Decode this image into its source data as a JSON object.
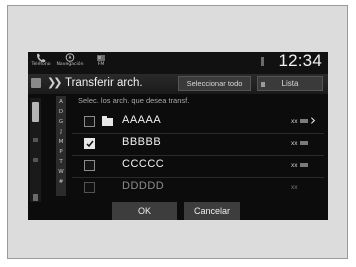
{
  "status_bar": {
    "items": [
      {
        "label": "Teléfono",
        "icon": "phone-icon"
      },
      {
        "label": "Navegación",
        "icon": "navigation-icon"
      },
      {
        "label": "FM",
        "icon": "radio-icon"
      }
    ],
    "time": "12:34"
  },
  "header": {
    "back_icon": "double-chevron-icon",
    "title": "Transferir arch.",
    "select_all_label": "Seleccionar todo",
    "list_label": "Lista"
  },
  "list": {
    "instruction": "Selec. los arch. que desea transf.",
    "alphabet_index": [
      "A",
      "D",
      "G",
      "J",
      "M",
      "P",
      "T",
      "W",
      "#"
    ],
    "rows": [
      {
        "name": "AAAAA",
        "checked": false,
        "folder": true,
        "meta": "xx"
      },
      {
        "name": "BBBBB",
        "checked": true,
        "folder": false,
        "meta": "xx"
      },
      {
        "name": "CCCCC",
        "checked": false,
        "folder": false,
        "meta": "xx"
      },
      {
        "name": "DDDDD",
        "checked": false,
        "folder": false,
        "meta": "xx"
      }
    ]
  },
  "footer": {
    "ok_label": "OK",
    "cancel_label": "Cancelar"
  },
  "colors": {
    "screen_bg": "#0c0c0c",
    "button_bg": "#3d3d3d",
    "text": "#f2f2f2"
  }
}
